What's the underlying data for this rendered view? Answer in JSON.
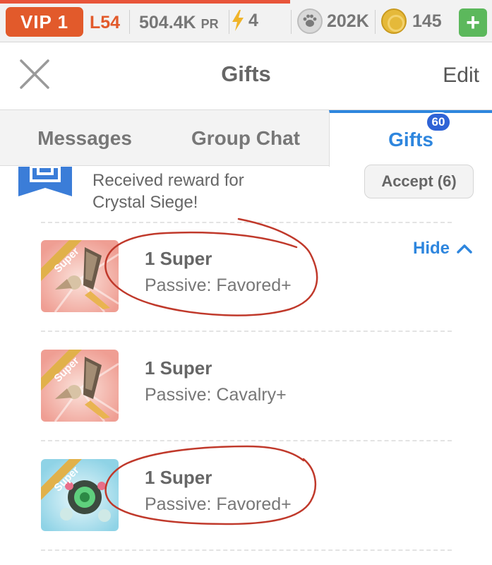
{
  "topbar": {
    "vip": "VIP 1",
    "level": "L54",
    "power_value": "504.4K",
    "power_unit": "PR",
    "energy": "4",
    "food": "202K",
    "gold": "145",
    "add_label": "+",
    "progress_percent": 59
  },
  "header": {
    "title": "Gifts",
    "edit_label": "Edit"
  },
  "tabs": [
    {
      "label": "Messages",
      "active": false
    },
    {
      "label": "Group Chat",
      "active": false
    },
    {
      "label": "Gifts",
      "active": true,
      "badge": "60"
    }
  ],
  "reward": {
    "line1": "Received reward for",
    "line2": "Crystal Siege!",
    "accept_label": "Accept (6)",
    "hide_label": "Hide"
  },
  "items": [
    {
      "tag": "Super",
      "title": "1 Super",
      "desc": "Passive: Favored+",
      "circled": true
    },
    {
      "tag": "Super",
      "title": "1 Super",
      "desc": "Passive: Cavalry+",
      "circled": false
    },
    {
      "tag": "Super",
      "title": "1 Super",
      "desc": "Passive: Favored+",
      "circled": true
    }
  ],
  "colors": {
    "accent": "#2e86de",
    "vip": "#e25a2b",
    "annotation": "#c0392b",
    "add_button": "#5cb85c"
  }
}
